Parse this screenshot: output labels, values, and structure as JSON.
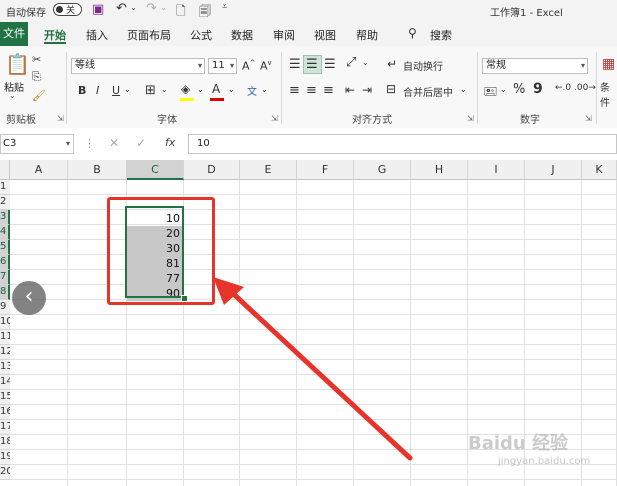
{
  "titlebar": {
    "autosave_label": "自动保存",
    "autosave_state": "关",
    "doc_title": "工作簿1 - Excel"
  },
  "tabs": [
    {
      "label": "文件"
    },
    {
      "label": "开始"
    },
    {
      "label": "插入"
    },
    {
      "label": "页面布局"
    },
    {
      "label": "公式"
    },
    {
      "label": "数据"
    },
    {
      "label": "审阅"
    },
    {
      "label": "视图"
    },
    {
      "label": "帮助"
    },
    {
      "label": "搜索"
    }
  ],
  "ribbon": {
    "paste_label": "粘贴",
    "clipboard_label": "剪贴板",
    "font_name": "等线",
    "font_size": "11",
    "font_group_label": "字体",
    "bold": "B",
    "italic": "I",
    "underline": "U",
    "wrap_text": "自动换行",
    "merge_center": "合并后居中",
    "align_group_label": "对齐方式",
    "number_format": "常规",
    "percent": "%",
    "comma": "9",
    "number_group_label": "数字",
    "cond_format_partial": "条件"
  },
  "formula_bar": {
    "name_box": "C3",
    "value": "10"
  },
  "columns": [
    "A",
    "B",
    "C",
    "D",
    "E",
    "F",
    "G",
    "H",
    "I",
    "J",
    "K"
  ],
  "rows": [
    "1",
    "2",
    "3",
    "4",
    "5",
    "6",
    "7",
    "8",
    "9",
    "10",
    "11",
    "12",
    "13",
    "14",
    "15",
    "16",
    "17",
    "18",
    "19",
    "20"
  ],
  "cells_c": [
    {
      "row": "3",
      "value": "10"
    },
    {
      "row": "4",
      "value": "20"
    },
    {
      "row": "5",
      "value": "30"
    },
    {
      "row": "6",
      "value": "81"
    },
    {
      "row": "7",
      "value": "77"
    },
    {
      "row": "8",
      "value": "90"
    }
  ],
  "watermark": {
    "brand": "Baidu 经验",
    "url": "jingyan.baidu.com"
  },
  "colors": {
    "excel_green": "#217346",
    "annotation_red": "#e8332a",
    "selection_fill": "#c8c8c8"
  }
}
